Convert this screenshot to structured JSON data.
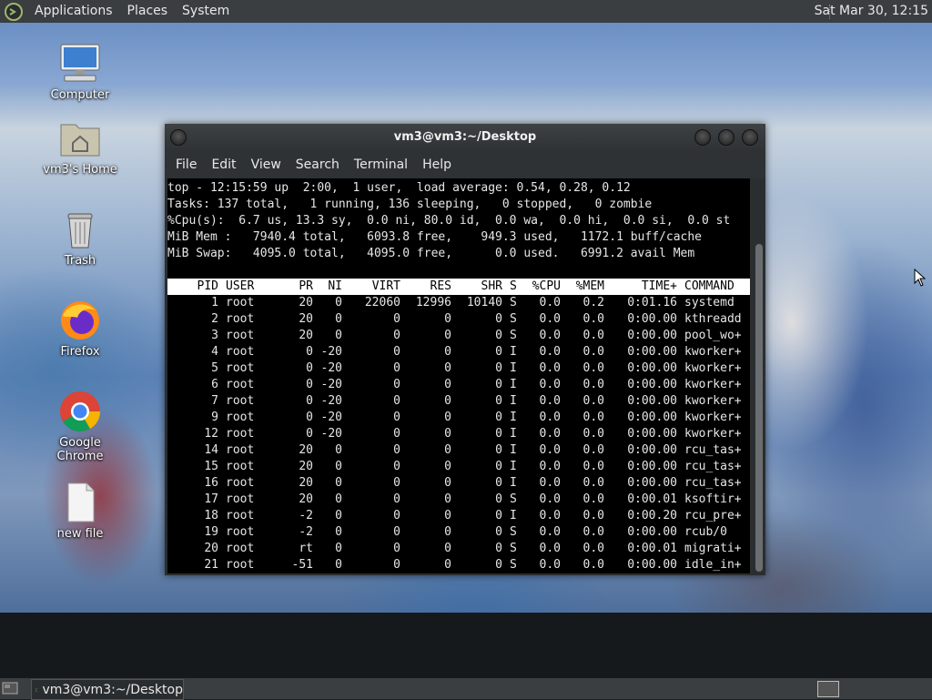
{
  "top_panel": {
    "menu": [
      "Applications",
      "Places",
      "System"
    ],
    "clock": "Sat Mar 30, 12:15"
  },
  "desktop_icons": [
    {
      "label": "Computer",
      "icon": "computer-icon"
    },
    {
      "label": "vm3's Home",
      "icon": "home-folder-icon"
    },
    {
      "label": "Trash",
      "icon": "trash-icon"
    },
    {
      "label": "Firefox",
      "icon": "firefox-icon"
    },
    {
      "label": "Google Chrome",
      "icon": "chrome-icon"
    },
    {
      "label": "new file",
      "icon": "file-icon"
    }
  ],
  "terminal": {
    "title": "vm3@vm3:~/Desktop",
    "menu": [
      "File",
      "Edit",
      "View",
      "Search",
      "Terminal",
      "Help"
    ],
    "top_summary": [
      "top - 12:15:59 up  2:00,  1 user,  load average: 0.54, 0.28, 0.12",
      "Tasks: 137 total,   1 running, 136 sleeping,   0 stopped,   0 zombie",
      "%Cpu(s):  6.7 us, 13.3 sy,  0.0 ni, 80.0 id,  0.0 wa,  0.0 hi,  0.0 si,  0.0 st",
      "MiB Mem :   7940.4 total,   6093.8 free,    949.3 used,   1172.1 buff/cache",
      "MiB Swap:   4095.0 total,   4095.0 free,      0.0 used.   6991.2 avail Mem"
    ],
    "columns": [
      "PID",
      "USER",
      "PR",
      "NI",
      "VIRT",
      "RES",
      "SHR",
      "S",
      "%CPU",
      "%MEM",
      "TIME+",
      "COMMAND"
    ],
    "processes": [
      [
        "1",
        "root",
        "20",
        "0",
        "22060",
        "12996",
        "10140",
        "S",
        "0.0",
        "0.2",
        "0:01.16",
        "systemd"
      ],
      [
        "2",
        "root",
        "20",
        "0",
        "0",
        "0",
        "0",
        "S",
        "0.0",
        "0.0",
        "0:00.00",
        "kthreadd"
      ],
      [
        "3",
        "root",
        "20",
        "0",
        "0",
        "0",
        "0",
        "S",
        "0.0",
        "0.0",
        "0:00.00",
        "pool_wo+"
      ],
      [
        "4",
        "root",
        "0",
        "-20",
        "0",
        "0",
        "0",
        "I",
        "0.0",
        "0.0",
        "0:00.00",
        "kworker+"
      ],
      [
        "5",
        "root",
        "0",
        "-20",
        "0",
        "0",
        "0",
        "I",
        "0.0",
        "0.0",
        "0:00.00",
        "kworker+"
      ],
      [
        "6",
        "root",
        "0",
        "-20",
        "0",
        "0",
        "0",
        "I",
        "0.0",
        "0.0",
        "0:00.00",
        "kworker+"
      ],
      [
        "7",
        "root",
        "0",
        "-20",
        "0",
        "0",
        "0",
        "I",
        "0.0",
        "0.0",
        "0:00.00",
        "kworker+"
      ],
      [
        "9",
        "root",
        "0",
        "-20",
        "0",
        "0",
        "0",
        "I",
        "0.0",
        "0.0",
        "0:00.00",
        "kworker+"
      ],
      [
        "12",
        "root",
        "0",
        "-20",
        "0",
        "0",
        "0",
        "I",
        "0.0",
        "0.0",
        "0:00.00",
        "kworker+"
      ],
      [
        "14",
        "root",
        "20",
        "0",
        "0",
        "0",
        "0",
        "I",
        "0.0",
        "0.0",
        "0:00.00",
        "rcu_tas+"
      ],
      [
        "15",
        "root",
        "20",
        "0",
        "0",
        "0",
        "0",
        "I",
        "0.0",
        "0.0",
        "0:00.00",
        "rcu_tas+"
      ],
      [
        "16",
        "root",
        "20",
        "0",
        "0",
        "0",
        "0",
        "I",
        "0.0",
        "0.0",
        "0:00.00",
        "rcu_tas+"
      ],
      [
        "17",
        "root",
        "20",
        "0",
        "0",
        "0",
        "0",
        "S",
        "0.0",
        "0.0",
        "0:00.01",
        "ksoftir+"
      ],
      [
        "18",
        "root",
        "-2",
        "0",
        "0",
        "0",
        "0",
        "I",
        "0.0",
        "0.0",
        "0:00.20",
        "rcu_pre+"
      ],
      [
        "19",
        "root",
        "-2",
        "0",
        "0",
        "0",
        "0",
        "S",
        "0.0",
        "0.0",
        "0:00.00",
        "rcub/0"
      ],
      [
        "20",
        "root",
        "rt",
        "0",
        "0",
        "0",
        "0",
        "S",
        "0.0",
        "0.0",
        "0:00.01",
        "migrati+"
      ],
      [
        "21",
        "root",
        "-51",
        "0",
        "0",
        "0",
        "0",
        "S",
        "0.0",
        "0.0",
        "0:00.00",
        "idle_in+"
      ]
    ]
  },
  "bottom_panel": {
    "task_label": "vm3@vm3:~/Desktop"
  }
}
